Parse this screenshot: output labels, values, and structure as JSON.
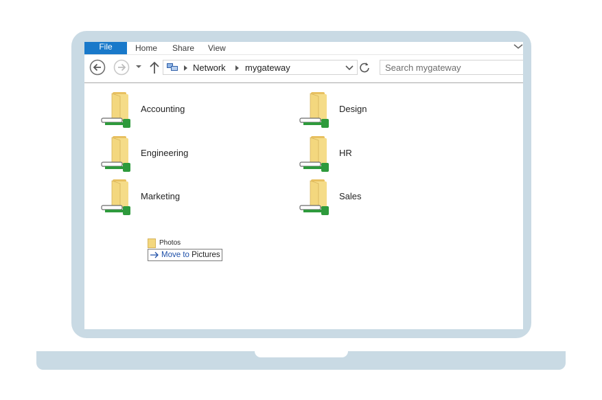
{
  "ribbon": {
    "tabs": [
      "File",
      "Home",
      "Share",
      "View"
    ]
  },
  "address": {
    "crumbs": [
      "Network",
      "mygateway"
    ]
  },
  "search": {
    "placeholder": "Search mygateway"
  },
  "folders": [
    {
      "label": "Accounting"
    },
    {
      "label": "Design"
    },
    {
      "label": "Engineering"
    },
    {
      "label": "HR"
    },
    {
      "label": "Marketing"
    },
    {
      "label": "Sales"
    }
  ],
  "drag": {
    "item_name": "Photos",
    "action_verb": "Move to",
    "target": "Pictures"
  },
  "colors": {
    "file_tab": "#1979ca",
    "frame": "#c9dae4",
    "folder_yellow": "#f3d77e",
    "network_green": "#2e9a3c"
  }
}
